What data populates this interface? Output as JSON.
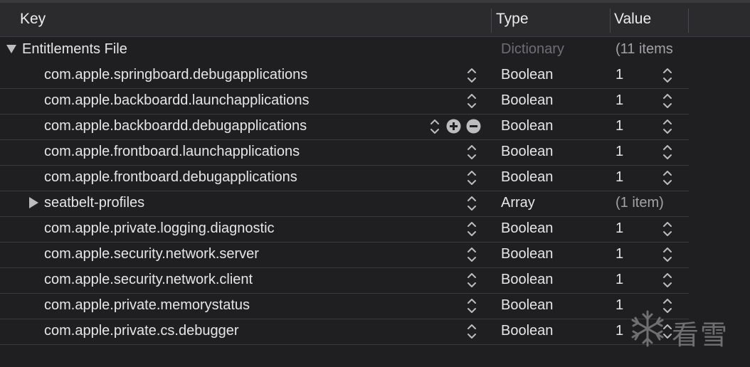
{
  "header": {
    "key_label": "Key",
    "type_label": "Type",
    "value_label": "Value"
  },
  "root": {
    "key": "Entitlements File",
    "type": "Dictionary",
    "value": "(11 items"
  },
  "rows": [
    {
      "key": "com.apple.springboard.debugapplications",
      "type": "Boolean",
      "value": "1"
    },
    {
      "key": "com.apple.backboardd.launchapplications",
      "type": "Boolean",
      "value": "1"
    },
    {
      "key": "com.apple.backboardd.debugapplications",
      "type": "Boolean",
      "value": "1"
    },
    {
      "key": "com.apple.frontboard.launchapplications",
      "type": "Boolean",
      "value": "1"
    },
    {
      "key": "com.apple.frontboard.debugapplications",
      "type": "Boolean",
      "value": "1"
    },
    {
      "key": "seatbelt-profiles",
      "type": "Array",
      "value": "(1 item)"
    },
    {
      "key": "com.apple.private.logging.diagnostic",
      "type": "Boolean",
      "value": "1"
    },
    {
      "key": "com.apple.security.network.server",
      "type": "Boolean",
      "value": "1"
    },
    {
      "key": "com.apple.security.network.client",
      "type": "Boolean",
      "value": "1"
    },
    {
      "key": "com.apple.private.memorystatus",
      "type": "Boolean",
      "value": "1"
    },
    {
      "key": "com.apple.private.cs.debugger",
      "type": "Boolean",
      "value": "1"
    }
  ],
  "watermark": {
    "text": "看雪"
  },
  "colors": {
    "background": "#1f1f21",
    "header": "#2b2b2e",
    "text": "#e6e6e6",
    "dim_text": "#6f6f73"
  }
}
